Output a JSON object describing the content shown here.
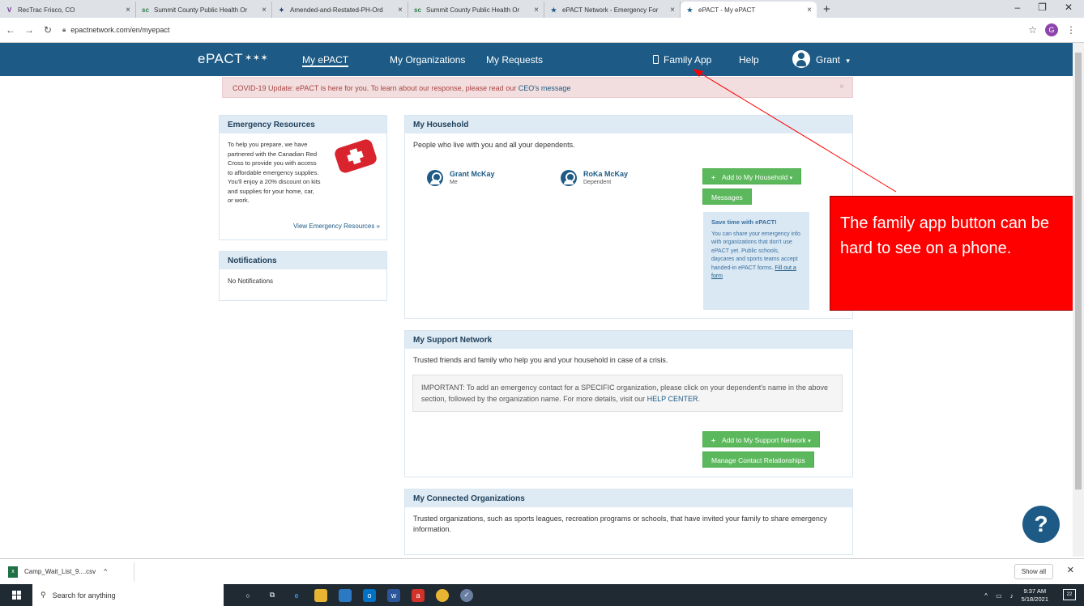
{
  "browser": {
    "tabs": [
      {
        "title": "RecTrac Frisco, CO",
        "favicon": "V"
      },
      {
        "title": "Summit County Public Health Or",
        "favicon": "sc"
      },
      {
        "title": "Amended-and-Restated-PH-Ord",
        "favicon": "✦"
      },
      {
        "title": "Summit County Public Health Or",
        "favicon": "sc"
      },
      {
        "title": "ePACT Network - Emergency For",
        "favicon": "★"
      },
      {
        "title": "ePACT - My ePACT",
        "favicon": "★"
      }
    ],
    "url": "epactnetwork.com/en/myepact",
    "profile_initial": "G"
  },
  "nav": {
    "logo": "ePACT",
    "logo_stars": "✶✶✶",
    "my_epact": "My ePACT",
    "my_orgs": "My Organizations",
    "my_requests": "My Requests",
    "family_app": "Family App",
    "help": "Help",
    "user": "Grant",
    "user_caret": "▾"
  },
  "alert": {
    "text": "COVID-19 Update: ePACT is here for you. To learn about our response, please read our ",
    "link": "CEO's message",
    "close": "×"
  },
  "emergency": {
    "title": "Emergency Resources",
    "body": "To help you prepare, we have partnered with the Canadian Red Cross to provide you with access to affordable emergency supplies. You'll enjoy a 20% discount on kits and supplies for your home, car, or work.",
    "link": "View Emergency Resources »"
  },
  "notifications": {
    "title": "Notifications",
    "body": "No Notifications"
  },
  "household": {
    "title": "My Household",
    "intro": "People who live with you and all your dependents.",
    "people": [
      {
        "name": "Grant McKay",
        "role": "Me"
      },
      {
        "name": "RoKa McKay",
        "role": "Dependent"
      }
    ],
    "add_button": "Add to My Household",
    "add_caret": "▾",
    "messages_button": "Messages",
    "save": {
      "title": "Save time with ePACT!",
      "body": "You can share your emergency info with organizations that don't use ePACT yet. Public schools, daycares and sports teams accept handed-in ePACT forms. ",
      "link": "Fill out a form"
    }
  },
  "support": {
    "title": "My Support Network",
    "intro": "Trusted friends and family who help you and your household in case of a crisis.",
    "important": "IMPORTANT: To add an emergency contact for a SPECIFIC organization, please click on your dependent's name in the above section, followed by the organization name. For more details, visit our ",
    "help_center": "HELP CENTER",
    "period": ".",
    "add_button": "Add to My Support Network",
    "add_caret": "▾",
    "manage_button": "Manage Contact Relationships"
  },
  "connected": {
    "title": "My Connected Organizations",
    "intro": "Trusted organizations, such as sports leagues, recreation programs or schools, that have invited your family to share emergency information."
  },
  "annotation": {
    "text": "The family app button can be hard to see on a phone.",
    "color": "#ff0000"
  },
  "help_fab": "?",
  "downloads": {
    "file": "Camp_Wait_List_9....csv",
    "show_all": "Show all"
  },
  "taskbar": {
    "search_placeholder": "Search for anything",
    "time": "9:37 AM",
    "date": "5/18/2021",
    "notif_count": "22"
  },
  "colors": {
    "brand": "#1d5b86",
    "green": "#5cb85c",
    "alert_bg": "#f2dede"
  }
}
